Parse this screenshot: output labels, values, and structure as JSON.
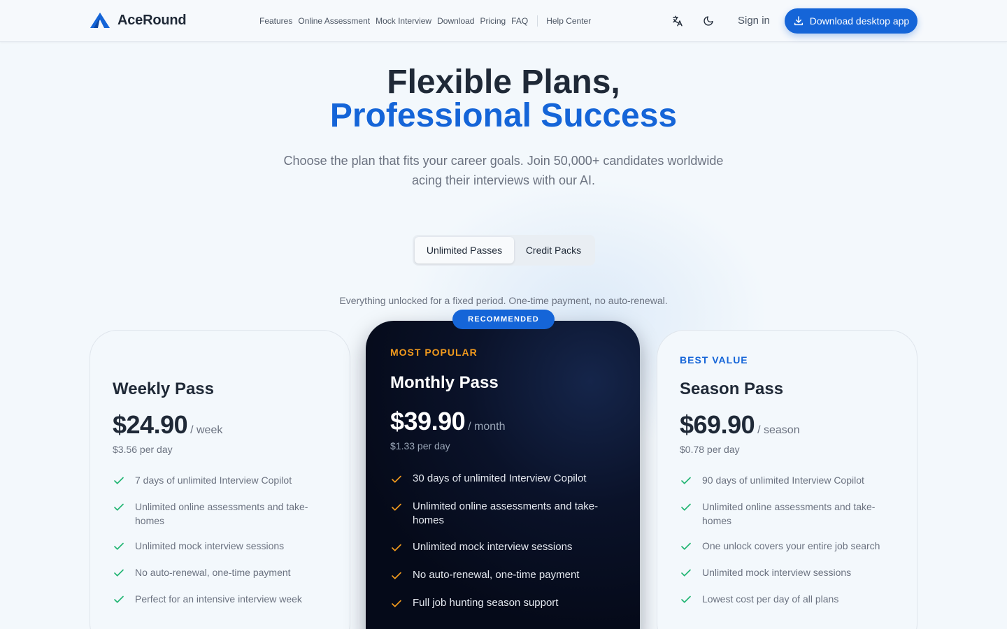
{
  "header": {
    "brand": "AceRound",
    "nav": [
      "Features",
      "Online Assessment",
      "Mock Interview",
      "Download",
      "Pricing",
      "FAQ"
    ],
    "help": "Help Center",
    "translate_icon": "translate-icon",
    "theme_icon": "moon-icon",
    "signin": "Sign in",
    "download_label": "Download desktop app",
    "accent": "#1565d8"
  },
  "hero": {
    "line1": "Flexible Plans,",
    "line2": "Professional Success",
    "subtitle": "Choose the plan that fits your career goals. Join 50,000+ candidates worldwide acing their interviews with our AI."
  },
  "toggle": {
    "options": [
      "Unlimited Passes",
      "Credit Packs"
    ],
    "selected": "Unlimited Passes",
    "note": "Everything unlocked for a fixed period. One-time payment, no auto-renewal."
  },
  "plans": [
    {
      "name": "Weekly Pass",
      "price": "$24.90",
      "unit": "/ week",
      "per_day": "$3.56 per day",
      "features": [
        "7 days of unlimited Interview Copilot",
        "Unlimited online assessments and take-homes",
        "Unlimited mock interview sessions",
        "No auto-renewal, one-time payment",
        "Perfect for an intensive interview week"
      ]
    },
    {
      "badge": "RECOMMENDED",
      "tag": "MOST POPULAR",
      "name": "Monthly Pass",
      "price": "$39.90",
      "unit": "/ month",
      "per_day": "$1.33 per day",
      "features": [
        "30 days of unlimited Interview Copilot",
        "Unlimited online assessments and take-homes",
        "Unlimited mock interview sessions",
        "No auto-renewal, one-time payment",
        "Full job hunting season support"
      ]
    },
    {
      "tag": "BEST VALUE",
      "name": "Season Pass",
      "price": "$69.90",
      "unit": "/ season",
      "per_day": "$0.78 per day",
      "features": [
        "90 days of unlimited Interview Copilot",
        "Unlimited online assessments and take-homes",
        "One unlock covers your entire job search",
        "Unlimited mock interview sessions",
        "Lowest cost per day of all plans"
      ]
    }
  ],
  "colors": {
    "check_green": "#22b573",
    "check_orange": "#f29a1d",
    "dark_card": "#050a19"
  }
}
